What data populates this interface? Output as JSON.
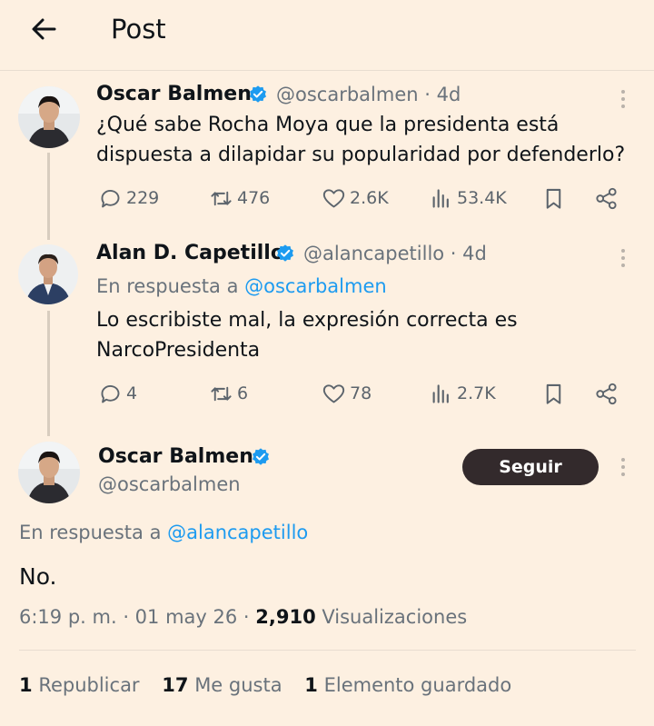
{
  "header": {
    "title": "Post",
    "back_icon": "arrow-left-icon"
  },
  "colors": {
    "background": "#fdf0e1",
    "accent": "#1d9bf0",
    "muted": "#69727b",
    "follow_button": "#332a2c"
  },
  "posts": [
    {
      "name": "Oscar Balmen",
      "handle": "@oscarbalmen · 4d",
      "text": "¿Qué sabe Rocha Moya que la presidenta está dispuesta a dilapidar su popularidad por defenderlo?",
      "replies": "229",
      "reposts": "476",
      "likes": "2.6K",
      "views": "53.4K"
    },
    {
      "name": "Alan D. Capetillo",
      "handle": "@alancapetillo · 4d",
      "reply_prefix": "En respuesta a",
      "reply_mention": "@oscarbalmen",
      "text": "Lo escribiste mal, la expresión correcta es NarcoPresidenta",
      "replies": "4",
      "reposts": "6",
      "likes": "78",
      "views": "2.7K"
    }
  ],
  "main_post": {
    "name": "Oscar Balmen",
    "handle": "@oscarbalmen",
    "follow_label": "Seguir",
    "reply_prefix": "En respuesta a",
    "reply_mention": "@alancapetillo",
    "text": "No.",
    "time": "6:19 p. m. · 01 may 26 · ",
    "views_count": "2,910",
    "views_label": " Visualizaciones",
    "stats": [
      {
        "count": "1",
        "label": "Republicar"
      },
      {
        "count": "17",
        "label": "Me gusta"
      },
      {
        "count": "1",
        "label": "Elemento guardado"
      }
    ]
  }
}
